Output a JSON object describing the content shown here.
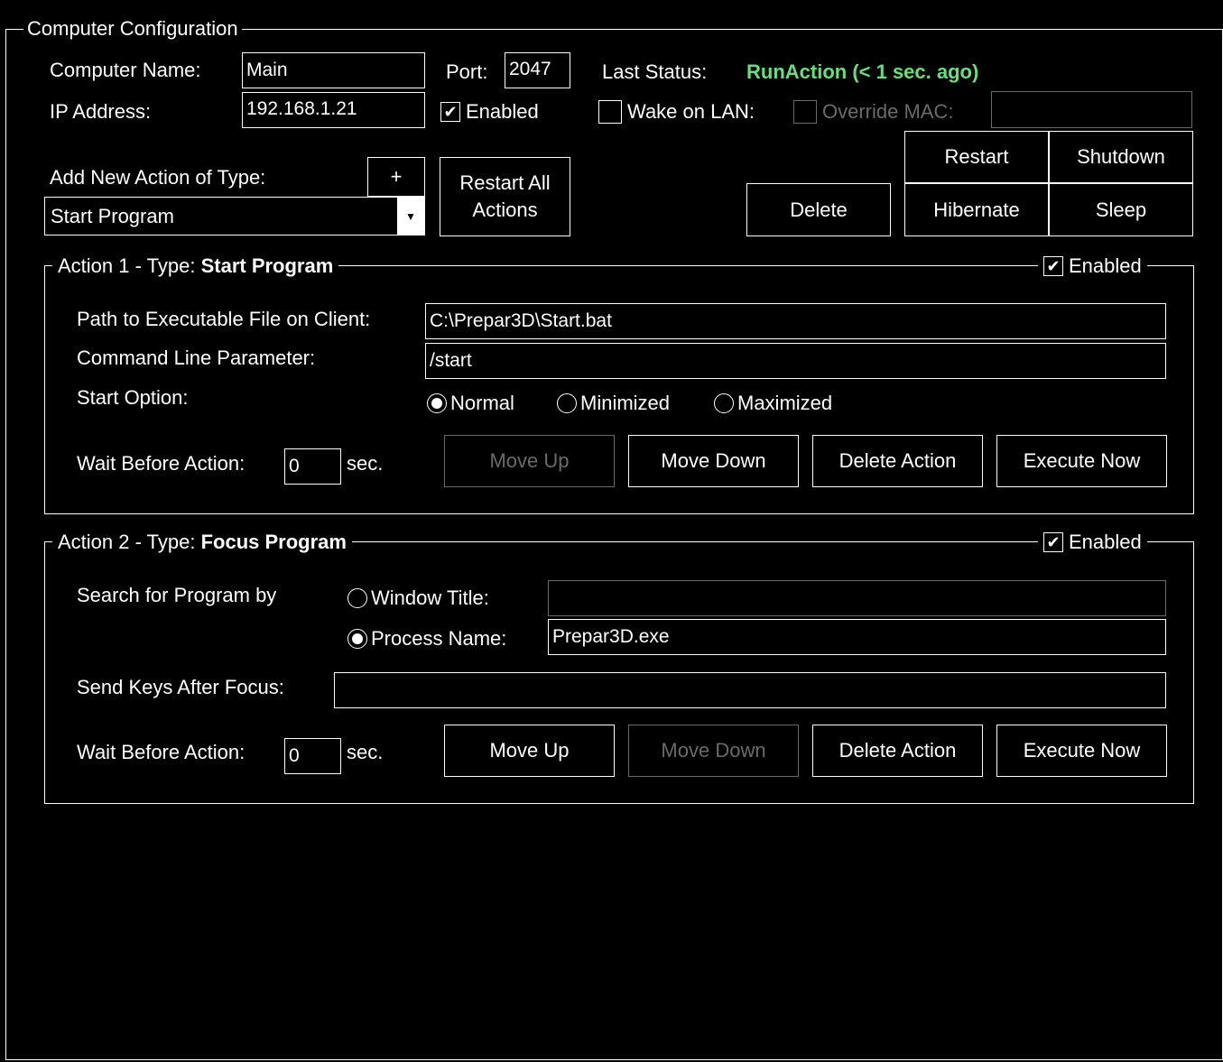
{
  "computer_config": {
    "legend": "Computer Configuration",
    "computer_name_label": "Computer Name:",
    "computer_name_value": "Main",
    "port_label": "Port:",
    "port_value": "2047",
    "last_status_label": "Last Status:",
    "last_status_value": "RunAction (< 1 sec. ago)",
    "ip_label": "IP Address:",
    "ip_value": "192.168.1.21",
    "enabled_label": "Enabled",
    "enabled_checked": true,
    "wol_label": "Wake on LAN:",
    "wol_checked": false,
    "override_mac_label": "Override MAC:",
    "override_mac_checked": false,
    "override_mac_value": "",
    "add_action_label": "Add New Action of Type:",
    "add_button": "+",
    "action_type_selected": "Start Program",
    "restart_all_line1": "Restart All",
    "restart_all_line2": "Actions",
    "delete_button": "Delete",
    "restart_button": "Restart",
    "shutdown_button": "Shutdown",
    "hibernate_button": "Hibernate",
    "sleep_button": "Sleep",
    "status_color": "#66e07a"
  },
  "action1": {
    "legend_prefix": "Action 1 - Type:",
    "legend_type": "Start Program",
    "enabled_label": "Enabled",
    "enabled_checked": true,
    "path_label": "Path to Executable File on Client:",
    "path_value": "C:\\Prepar3D\\Start.bat",
    "cmd_label": "Command Line Parameter:",
    "cmd_value": "/start",
    "start_option_label": "Start Option:",
    "options": [
      "Normal",
      "Minimized",
      "Maximized"
    ],
    "selected_option": "Normal",
    "wait_label": "Wait Before Action:",
    "wait_value": "0",
    "wait_unit": "sec.",
    "move_up": "Move Up",
    "move_down": "Move Down",
    "delete_action": "Delete Action",
    "execute_now": "Execute Now"
  },
  "action2": {
    "legend_prefix": "Action 2 - Type:",
    "legend_type": "Focus Program",
    "enabled_label": "Enabled",
    "enabled_checked": true,
    "search_label": "Search for Program by",
    "window_title_label": "Window Title:",
    "window_title_value": "",
    "process_name_label": "Process Name:",
    "process_name_value": "Prepar3D.exe",
    "selected_search": "Process Name",
    "send_keys_label": "Send Keys After Focus:",
    "send_keys_value": "",
    "wait_label": "Wait Before Action:",
    "wait_value": "0",
    "wait_unit": "sec.",
    "move_up": "Move Up",
    "move_down": "Move Down",
    "delete_action": "Delete Action",
    "execute_now": "Execute Now"
  }
}
